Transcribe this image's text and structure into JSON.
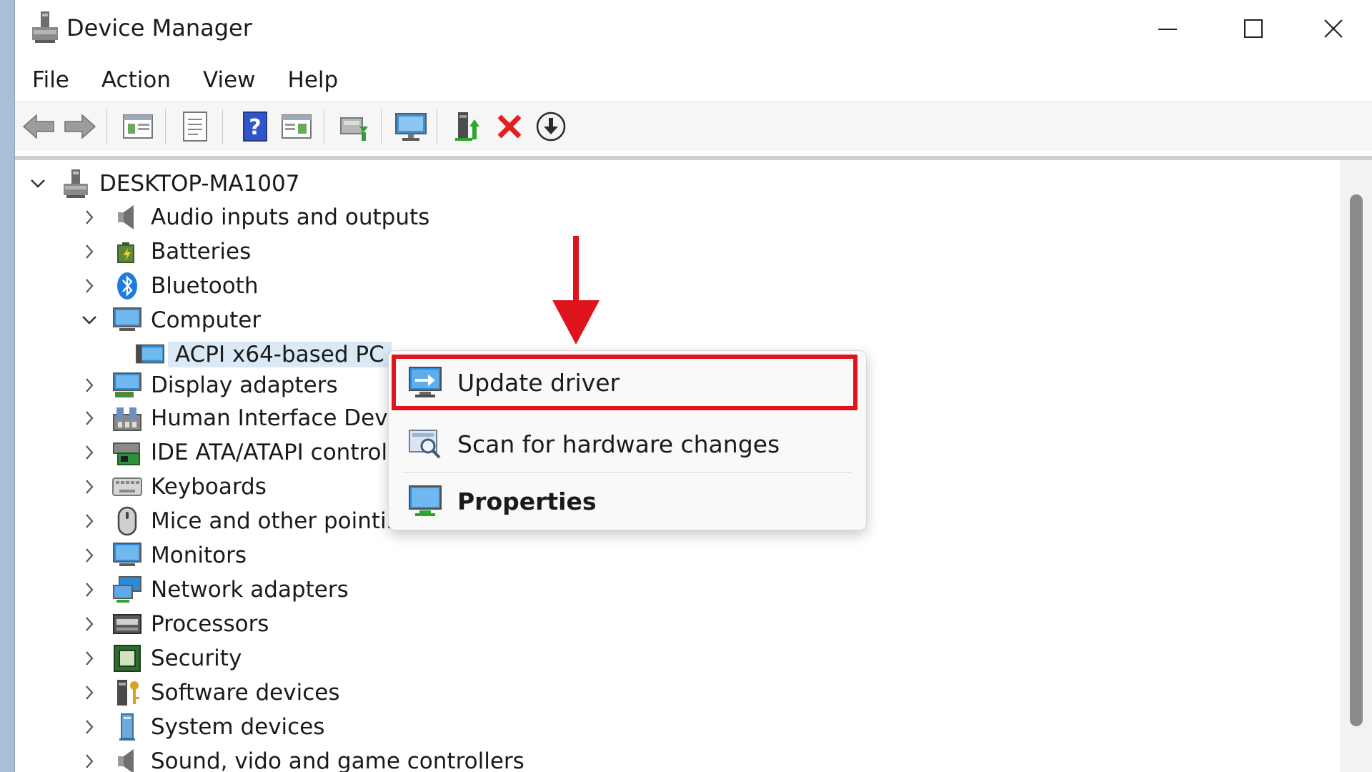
{
  "window": {
    "title": "Device Manager"
  },
  "menu": [
    {
      "label": "File"
    },
    {
      "label": "Action"
    },
    {
      "label": "View"
    },
    {
      "label": "Help"
    }
  ],
  "toolbar": {
    "buttons": [
      "back-icon",
      "forward-icon",
      "show-hide-console-tree-icon",
      "properties-icon",
      "help-icon",
      "action-pane-icon",
      "scan-hardware-icon",
      "monitor-icon",
      "update-driver-icon",
      "uninstall-device-icon",
      "disable-device-icon"
    ]
  },
  "tree": {
    "root": {
      "label": "DESKTOP-MA1007"
    },
    "items": [
      {
        "label": "Audio inputs and outputs",
        "icon": "speaker-icon"
      },
      {
        "label": "Batteries",
        "icon": "battery-icon"
      },
      {
        "label": "Bluetooth",
        "icon": "bluetooth-icon"
      },
      {
        "label": "Computer",
        "icon": "computer-icon",
        "expanded": true
      },
      {
        "label": "ACPI x64-based PC",
        "icon": "pc-icon",
        "child": true,
        "selected": true
      },
      {
        "label": "Display adapters",
        "icon": "display-adapter-icon"
      },
      {
        "label": "Human Interface Devic",
        "icon": "hid-icon"
      },
      {
        "label": "IDE ATA/ATAPI controlle",
        "icon": "ide-controller-icon"
      },
      {
        "label": "Keyboards",
        "icon": "keyboard-icon"
      },
      {
        "label": "Mice and other pointin",
        "icon": "mouse-icon"
      },
      {
        "label": "Monitors",
        "icon": "monitor-icon"
      },
      {
        "label": "Network adapters",
        "icon": "network-adapter-icon"
      },
      {
        "label": "Processors",
        "icon": "processor-icon"
      },
      {
        "label": "Security",
        "icon": "security-chip-icon"
      },
      {
        "label": "Software devices",
        "icon": "software-device-icon"
      },
      {
        "label": "System devices",
        "icon": "system-device-icon"
      },
      {
        "label": "Sound, vido and game controllers",
        "icon": "speaker-icon"
      }
    ]
  },
  "context_menu": {
    "items": [
      {
        "label": "Update driver",
        "icon": "update-driver-icon",
        "highlighted": true
      },
      {
        "label": "Scan for hardware changes",
        "icon": "scan-hardware-icon"
      },
      {
        "label": "Properties",
        "icon": "properties-monitor-icon",
        "bold": true
      }
    ]
  },
  "colors": {
    "highlight": "#e0141c",
    "selection": "#dbe8f6",
    "arrow": "#e0141c"
  }
}
